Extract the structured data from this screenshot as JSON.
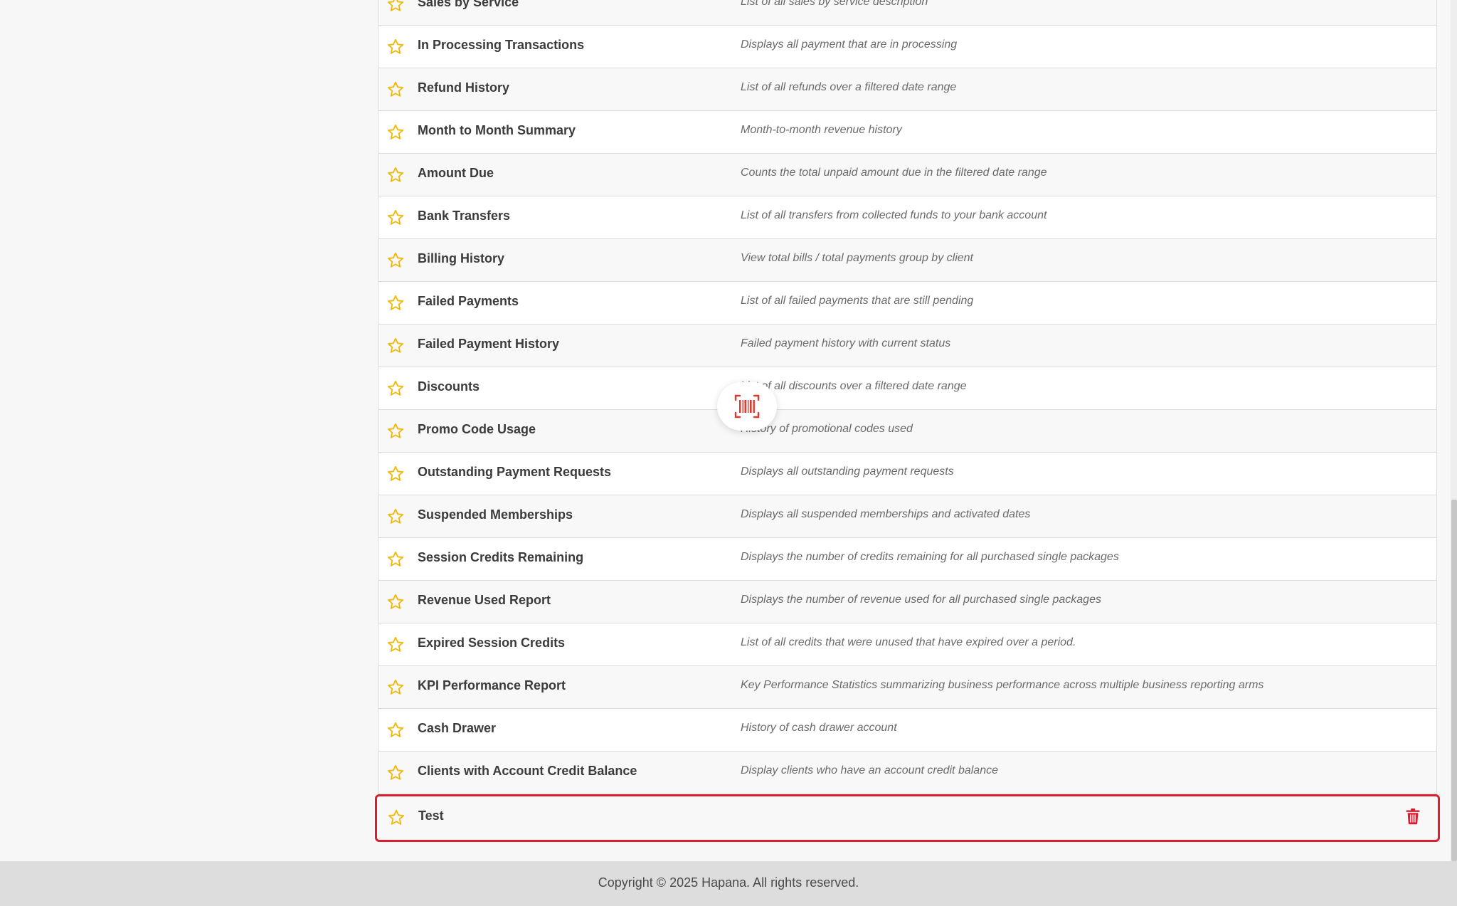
{
  "reports": [
    {
      "name": "Sales by Service",
      "description": "List of all sales by service description"
    },
    {
      "name": "In Processing Transactions",
      "description": "Displays all payment that are in processing"
    },
    {
      "name": "Refund History",
      "description": "List of all refunds over a filtered date range"
    },
    {
      "name": "Month to Month Summary",
      "description": "Month-to-month revenue history"
    },
    {
      "name": "Amount Due",
      "description": "Counts the total unpaid amount due in the filtered date range"
    },
    {
      "name": "Bank Transfers",
      "description": "List of all transfers from collected funds to your bank account"
    },
    {
      "name": "Billing History",
      "description": "View total bills / total payments group by client"
    },
    {
      "name": "Failed Payments",
      "description": "List of all failed payments that are still pending"
    },
    {
      "name": "Failed Payment History",
      "description": "Failed payment history with current status"
    },
    {
      "name": "Discounts",
      "description": "List of all discounts over a filtered date range"
    },
    {
      "name": "Promo Code Usage",
      "description": "History of promotional codes used"
    },
    {
      "name": "Outstanding Payment Requests",
      "description": "Displays all outstanding payment requests"
    },
    {
      "name": "Suspended Memberships",
      "description": "Displays all suspended memberships and activated dates"
    },
    {
      "name": "Session Credits Remaining",
      "description": "Displays the number of credits remaining for all purchased single packages"
    },
    {
      "name": "Revenue Used Report",
      "description": "Displays the number of revenue used for all purchased single packages"
    },
    {
      "name": "Expired Session Credits",
      "description": "List of all credits that were unused that have expired over a period."
    },
    {
      "name": "KPI Performance Report",
      "description": "Key Performance Statistics summarizing business performance across multiple business reporting arms"
    },
    {
      "name": "Cash Drawer",
      "description": "History of cash drawer account"
    },
    {
      "name": "Clients with Account Credit Balance",
      "description": "Display clients who have an account credit balance"
    }
  ],
  "custom_report": {
    "name": "Test",
    "description": ""
  },
  "footer": {
    "copyright": "Copyright © 2025 Hapana. All rights reserved."
  },
  "icons": {
    "favorite": "star-outline-icon",
    "delete": "trash-icon",
    "scan": "barcode-scan-icon"
  },
  "colors": {
    "star": "#f0b90b",
    "accent": "#d71f30",
    "text": "#3b3b3b",
    "description": "#6a6a6a",
    "footer_bg": "#dddddd"
  }
}
